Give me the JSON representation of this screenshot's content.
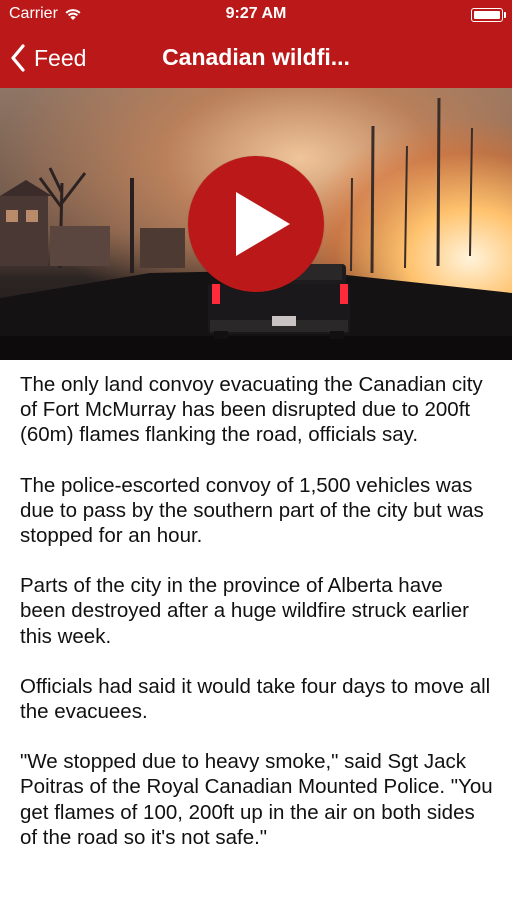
{
  "status_bar": {
    "carrier": "Carrier",
    "time": "9:27 AM",
    "wifi_icon": "wifi-icon",
    "battery_icon": "battery-icon"
  },
  "nav": {
    "back_label": "Feed",
    "back_icon": "chevron-left-icon",
    "title": "Canadian wildfi...",
    "bar_color": "#bb1919"
  },
  "video": {
    "play_icon": "play-icon",
    "play_button_color": "#bb1919"
  },
  "article": {
    "paragraphs": [
      "The only land convoy evacuating the Canadian city of Fort McMurray has been disrupted due to 200ft (60m) flames flanking the road, officials say.",
      "The police-escorted convoy of 1,500 vehicles was due to pass by the southern part of the city but was stopped for an hour.",
      "Parts of the city in the province of Alberta have been destroyed after a huge wildfire struck earlier this week.",
      "Officials had said it would take four days to move all the evacuees.",
      "\"We stopped due to heavy smoke,\" said Sgt Jack Poitras of the Royal Canadian Mounted Police. \"You get flames of 100, 200ft up in the air on both sides of the road so it's not safe.\""
    ]
  }
}
